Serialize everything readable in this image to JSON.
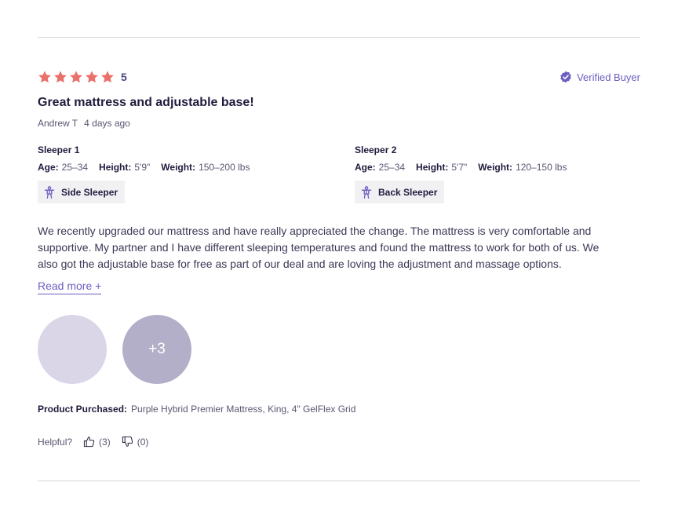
{
  "review": {
    "rating": "5",
    "rating_value": 5,
    "rating_max": 5,
    "star_color": "#e8716a",
    "verified_label": "Verified Buyer",
    "accent_color": "#6a5fc1",
    "title": "Great mattress and adjustable base!",
    "author": "Andrew T",
    "date": "4 days ago",
    "sleepers": [
      {
        "name": "Sleeper 1",
        "age_label": "Age:",
        "age": "25–34",
        "height_label": "Height:",
        "height": "5'9\"",
        "weight_label": "Weight:",
        "weight": "150–200 lbs",
        "position": "Side Sleeper",
        "position_icon": "person-icon"
      },
      {
        "name": "Sleeper 2",
        "age_label": "Age:",
        "age": "25–34",
        "height_label": "Height:",
        "height": "5'7\"",
        "weight_label": "Weight:",
        "weight": "120–150 lbs",
        "position": "Back Sleeper",
        "position_icon": "person-icon"
      }
    ],
    "body": "We recently upgraded our mattress and have really appreciated the change. The mattress is very comfortable and supportive. My partner and I have different sleeping temperatures and found the mattress to work for both of us. We also got the adjustable base for free as part of our deal and are loving the adjustment and massage options.",
    "read_more": "Read more +",
    "photos_more": "+3",
    "product_label": "Product Purchased:",
    "product": "Purple Hybrid Premier Mattress, King, 4\" GelFlex Grid",
    "helpful_label": "Helpful?",
    "helpful_yes": "(3)",
    "helpful_no": "(0)"
  }
}
